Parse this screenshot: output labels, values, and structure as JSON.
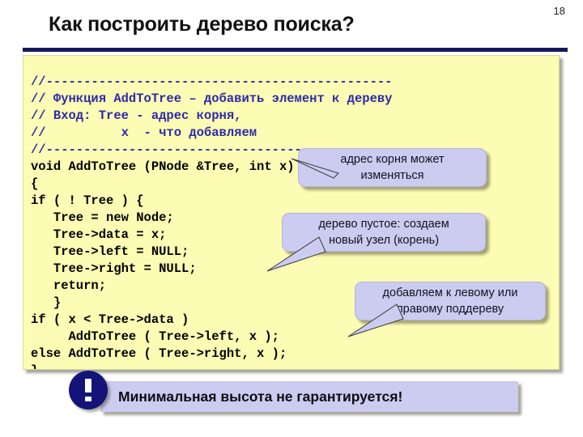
{
  "slide": {
    "number": "18",
    "title": "Как построить дерево поиска?"
  },
  "code": {
    "language": "C++",
    "lines": [
      {
        "text": "//----------------------------------------------",
        "kind": "comment"
      },
      {
        "text": "// Функция AddToTree – добавить элемент к дереву",
        "kind": "comment"
      },
      {
        "text": "// Вход: Tree - адрес корня,",
        "kind": "comment"
      },
      {
        "text": "//          x  - что добавляем",
        "kind": "comment"
      },
      {
        "text": "//----------------------------------------------",
        "kind": "comment"
      },
      {
        "text": "void AddToTree (PNode &Tree, int x)",
        "kind": "code"
      },
      {
        "text": "{",
        "kind": "code"
      },
      {
        "text": "if ( ! Tree ) {",
        "kind": "code"
      },
      {
        "text": "   Tree = new Node;",
        "kind": "code"
      },
      {
        "text": "   Tree->data = x;",
        "kind": "code"
      },
      {
        "text": "   Tree->left = NULL;",
        "kind": "code"
      },
      {
        "text": "   Tree->right = NULL;",
        "kind": "code"
      },
      {
        "text": "   return;",
        "kind": "code"
      },
      {
        "text": "   }",
        "kind": "code"
      },
      {
        "text": "if ( x < Tree->data )",
        "kind": "code"
      },
      {
        "text": "     AddToTree ( Tree->left, x );",
        "kind": "code"
      },
      {
        "text": "else AddToTree ( Tree->right, x );",
        "kind": "code"
      },
      {
        "text": "}",
        "kind": "code"
      }
    ]
  },
  "callouts": [
    {
      "id": "root-address",
      "line1": "адрес корня может",
      "line2": "изменяться",
      "text": "адрес корня может изменяться"
    },
    {
      "id": "empty-tree",
      "line1": "дерево пустое: создаем",
      "line2": "новый узел (корень)",
      "text": "дерево пустое: создаем новый узел (корень)"
    },
    {
      "id": "subtree",
      "line1": "добавляем к левому или",
      "line2": "правому поддереву",
      "text": "добавляем к левому или правому поддереву"
    }
  ],
  "note": {
    "icon": "exclamation-icon",
    "text": "Минимальная высота не гарантируется!"
  },
  "colors": {
    "code_background": "#fcfcb4",
    "comment_text": "#2c2ca8",
    "code_text": "#000000",
    "callout_fill": "#ccccf0",
    "rule": "#17175e",
    "note_icon": "#141478",
    "page_background": "#ffffff"
  }
}
